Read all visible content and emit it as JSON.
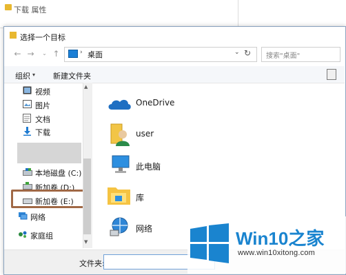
{
  "background_window": {
    "title": "下载 属性"
  },
  "dialog": {
    "title": "选择一个目标",
    "address": {
      "current": "桌面",
      "search_placeholder": "搜索\"桌面\""
    },
    "toolbar": {
      "organize": "组织",
      "new_folder": "新建文件夹"
    },
    "sidebar": {
      "items": [
        {
          "label": "视频",
          "icon": "video-icon"
        },
        {
          "label": "图片",
          "icon": "picture-icon"
        },
        {
          "label": "文档",
          "icon": "document-icon"
        },
        {
          "label": "下载",
          "icon": "download-icon"
        },
        {
          "label": "本地磁盘 (C:)",
          "icon": "drive-icon"
        },
        {
          "label": "新加卷 (D:)",
          "icon": "drive-icon"
        },
        {
          "label": "新加卷 (E:)",
          "icon": "drive-icon",
          "highlighted": true
        },
        {
          "label": "网络",
          "icon": "network-icon"
        },
        {
          "label": "家庭组",
          "icon": "homegroup-icon"
        }
      ]
    },
    "content": {
      "items": [
        {
          "label": "OneDrive",
          "icon": "onedrive-icon"
        },
        {
          "label": "user",
          "icon": "user-folder-icon"
        },
        {
          "label": "此电脑",
          "icon": "computer-icon"
        },
        {
          "label": "库",
          "icon": "library-icon"
        },
        {
          "label": "网络",
          "icon": "network-icon"
        }
      ]
    },
    "bottom": {
      "folder_label": "文件夹:",
      "folder_value": ""
    }
  },
  "watermark": {
    "title_latin": "Win10",
    "title_cn": "之家",
    "url": "www.win10xitong.com"
  },
  "colors": {
    "accent": "#1a84cf",
    "highlight_border": "#a06845"
  }
}
